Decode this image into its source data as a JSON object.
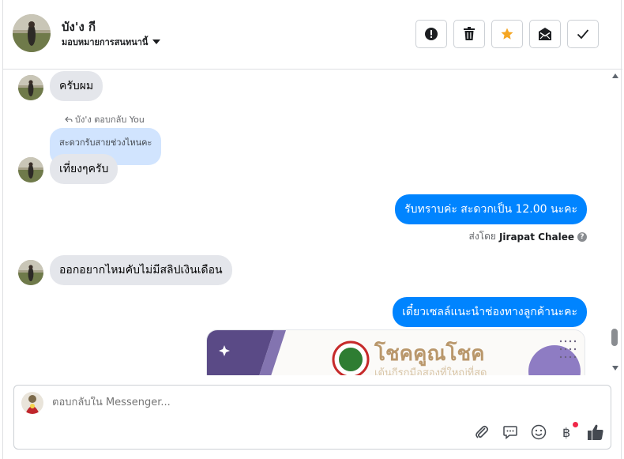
{
  "header": {
    "name": "บัง'ง กี",
    "assign_label": "มอบหมายการสนทนานี้",
    "toolbar": [
      {
        "name": "mark-spam-button",
        "icon": "alert-icon"
      },
      {
        "name": "delete-button",
        "icon": "trash-icon"
      },
      {
        "name": "star-button",
        "icon": "star-icon"
      },
      {
        "name": "mark-unread-button",
        "icon": "envelope-icon"
      },
      {
        "name": "mark-done-button",
        "icon": "check-icon"
      }
    ]
  },
  "messages": {
    "m1": "ครับผม",
    "reply_meta": "บัง'ง ตอบกลับ You",
    "quoted": "สะดวกรับสายช่วงไหนคะ",
    "m2": "เที่ยงๆครับ",
    "m3": "รับทราบค่ะ สะดวกเป็น 12.00  นะคะ",
    "sent_by_prefix": "ส่งโดย",
    "sent_by_name": "Jirapat Chalee",
    "m4": "ออกอยากไหมคับไม่มีสลิปเงินเดือน",
    "m5": "เดี๋ยวเซลล์แนะนำช่องทางลูกค้านะคะ",
    "banner": {
      "title": "โชคคูณโชค",
      "subtitle": "เต้นกีรกมือสองที่ใหญ่ที่สุด"
    }
  },
  "composer": {
    "placeholder": "ตอบกลับใน Messenger...",
    "tools": [
      "paperclip-icon",
      "chat-bubble-icon",
      "emoji-icon",
      "baht-icon",
      "thumbs-up-icon"
    ]
  },
  "colors": {
    "outgoing": "#0084ff",
    "incoming": "#e4e6eb",
    "quoted": "#d1e4fe",
    "star": "#f5a623"
  }
}
